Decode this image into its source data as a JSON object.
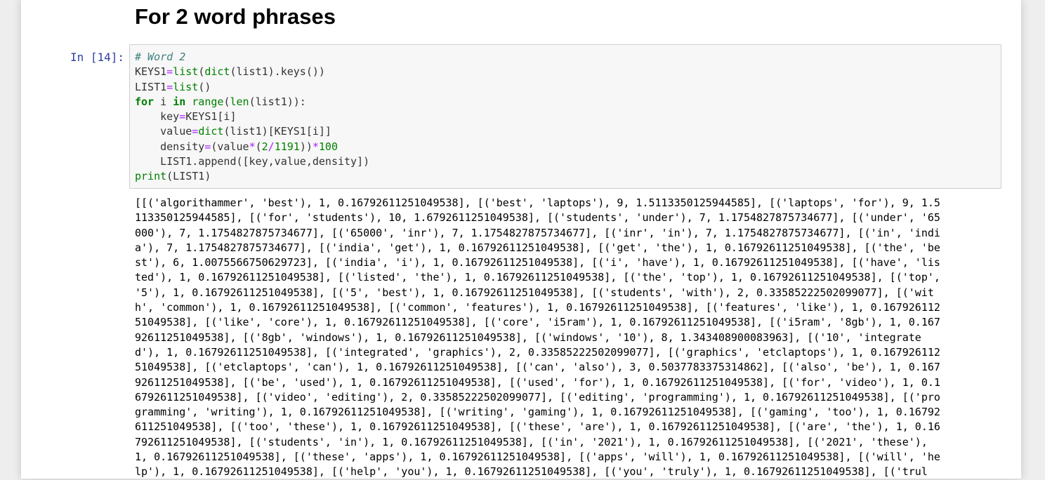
{
  "heading": "For 2 word phrases",
  "cell": {
    "prompt": "In [14]:",
    "code": {
      "comment": "# Word 2",
      "line2_a": "KEYS1",
      "line2_b": "list",
      "line2_c": "(",
      "line2_d": "dict",
      "line2_e": "(list1).keys())",
      "line3_a": "LIST1",
      "line3_b": "list",
      "line3_c": "()",
      "line4_for": "for",
      "line4_a": " i ",
      "line4_in": "in",
      "line4_b": " ",
      "line4_range": "range",
      "line4_c": "(",
      "line4_len": "len",
      "line4_d": "(list1)):",
      "line5_a": "    key",
      "line5_b": "KEYS1[i]",
      "line6_a": "    value",
      "line6_dict": "dict",
      "line6_b": "(list1)[KEYS1[i]]",
      "line7_a": "    density",
      "line7_b": "(value",
      "line7_c": "(",
      "line7_d": "2",
      "line7_e": "1191",
      "line7_f": "))",
      "line7_g": "100",
      "line8": "    LIST1.append([key,value,density])",
      "line9_print": "print",
      "line9_a": "(LIST1)"
    },
    "output_lines": [
      "[[('algorithammer', 'best'), 1, 0.16792611251049538], [('best', 'laptops'), 9, 1.5113350125944585], [('laptops', 'for'), 9, 1.5",
      "113350125944585], [('for', 'students'), 10, 1.6792611251049538], [('students', 'under'), 7, 1.1754827875734677], [('under', '65",
      "000'), 7, 1.1754827875734677], [('65000', 'inr'), 7, 1.1754827875734677], [('inr', 'in'), 7, 1.1754827875734677], [('in', 'indi",
      "a'), 7, 1.1754827875734677], [('india', 'get'), 1, 0.16792611251049538], [('get', 'the'), 1, 0.16792611251049538], [('the', 'be",
      "st'), 6, 1.0075566750629723], [('india', 'i'), 1, 0.16792611251049538], [('i', 'have'), 1, 0.16792611251049538], [('have', 'lis",
      "ted'), 1, 0.16792611251049538], [('listed', 'the'), 1, 0.16792611251049538], [('the', 'top'), 1, 0.16792611251049538], [('top',",
      "'5'), 1, 0.16792611251049538], [('5', 'best'), 1, 0.16792611251049538], [('students', 'with'), 2, 0.33585222502099077], [('wit",
      "h', 'common'), 1, 0.16792611251049538], [('common', 'features'), 1, 0.16792611251049538], [('features', 'like'), 1, 0.167926112",
      "51049538], [('like', 'core'), 1, 0.16792611251049538], [('core', 'i5ram'), 1, 0.16792611251049538], [('i5ram', '8gb'), 1, 0.167",
      "92611251049538], [('8gb', 'windows'), 1, 0.16792611251049538], [('windows', '10'), 8, 1.343408900083963], [('10', 'integrate",
      "d'), 1, 0.16792611251049538], [('integrated', 'graphics'), 2, 0.33585222502099077], [('graphics', 'etclaptops'), 1, 0.167926112",
      "51049538], [('etclaptops', 'can'), 1, 0.16792611251049538], [('can', 'also'), 3, 0.5037783375314862], [('also', 'be'), 1, 0.167",
      "92611251049538], [('be', 'used'), 1, 0.16792611251049538], [('used', 'for'), 1, 0.16792611251049538], [('for', 'video'), 1, 0.1",
      "6792611251049538], [('video', 'editing'), 2, 0.33585222502099077], [('editing', 'programming'), 1, 0.16792611251049538], [('pro",
      "gramming', 'writing'), 1, 0.16792611251049538], [('writing', 'gaming'), 1, 0.16792611251049538], [('gaming', 'too'), 1, 0.16792",
      "611251049538], [('too', 'these'), 1, 0.16792611251049538], [('these', 'are'), 1, 0.16792611251049538], [('are', 'the'), 1, 0.16",
      "792611251049538], [('students', 'in'), 1, 0.16792611251049538], [('in', '2021'), 1, 0.16792611251049538], [('2021', 'these'),",
      "1, 0.16792611251049538], [('these', 'apps'), 1, 0.16792611251049538], [('apps', 'will'), 1, 0.16792611251049538], [('will', 'he",
      "lp'), 1, 0.16792611251049538], [('help', 'you'), 1, 0.16792611251049538], [('you', 'truly'), 1, 0.16792611251049538], [('trul"
    ]
  }
}
